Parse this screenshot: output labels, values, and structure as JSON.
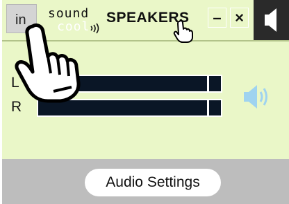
{
  "window": {
    "tab_label": "in",
    "logo_line1": "sound",
    "logo_line2": "cool",
    "title": "SPEAKERS",
    "minimize_label": "–",
    "close_label": "×"
  },
  "meters": {
    "left_label": "L",
    "right_label": "R",
    "left_level": 0.91,
    "right_level": 0.91
  },
  "footer": {
    "audio_settings_label": "Audio Settings"
  },
  "colors": {
    "panel_bg": "#eaf7c8",
    "meter_bg": "#0a1626",
    "bottom_bar": "#bdbdbd",
    "speaker_accent": "#9fd3f0"
  },
  "icons": {
    "mute": "speaker-mute-icon",
    "volume": "speaker-volume-icon",
    "pointer_big": "hand-pointer-icon",
    "pointer_small": "hand-cursor-icon"
  }
}
